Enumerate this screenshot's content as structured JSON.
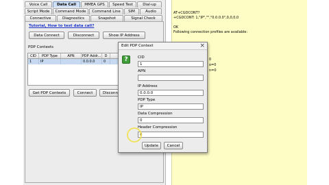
{
  "tabs": {
    "row1": [
      "Voice Call",
      "Data Call",
      "MMEA GPS",
      "Speed Test",
      "Dial-up"
    ],
    "row2": [
      "Script Mode",
      "Command Mode",
      "Command Line",
      "SIM",
      "Audio"
    ],
    "row3": [
      "Connective",
      "Diagnostics",
      "Snapshot",
      "Signal Check"
    ],
    "active": "Data Call"
  },
  "data_call": {
    "tutorial_link": "Tutorial, How to test data call?",
    "buttons": {
      "data_connect": "Data Connect",
      "disconnect": "Disconnect",
      "show_ip": "Show IP Address",
      "get_pdp": "Get PDP Contexts",
      "connect": "Connect",
      "disconnect_bottom": "Disconn"
    },
    "pdp_contexts_label": "PDP Contexts",
    "table": {
      "columns": [
        "CID",
        "PDP Type",
        "APN",
        "PDP Addr...",
        "D"
      ],
      "rows": [
        [
          "1",
          "IP",
          "",
          "0.0.0.0",
          "0"
        ]
      ]
    }
  },
  "log": {
    "lines": [
      "AT+CGDCONT?",
      "+CGDCONT: 1,\"IP\",\"\",\"0.0.0.0\",0,0,0,0",
      "OK",
      "Following connection profiles are available:"
    ],
    "faint_fragments": [
      "0",
      "o=0",
      "n=0"
    ]
  },
  "dialog": {
    "title": "Edit PDP Context",
    "close_glyph": "×",
    "question_glyph": "?",
    "fields": {
      "cid_label": "CID",
      "cid_value": "1",
      "apn_label": "APN",
      "apn_value": "",
      "ip_label": "IP Address",
      "ip_value": "0.0.0.0",
      "pdp_type_label": "PDP Type",
      "pdp_type_value": "IP",
      "data_comp_label": "Data Compression",
      "data_comp_value": "0",
      "header_comp_label": "Header Compression",
      "header_comp_value": "0"
    },
    "buttons": {
      "update": "Update",
      "cancel": "Cancel"
    }
  }
}
